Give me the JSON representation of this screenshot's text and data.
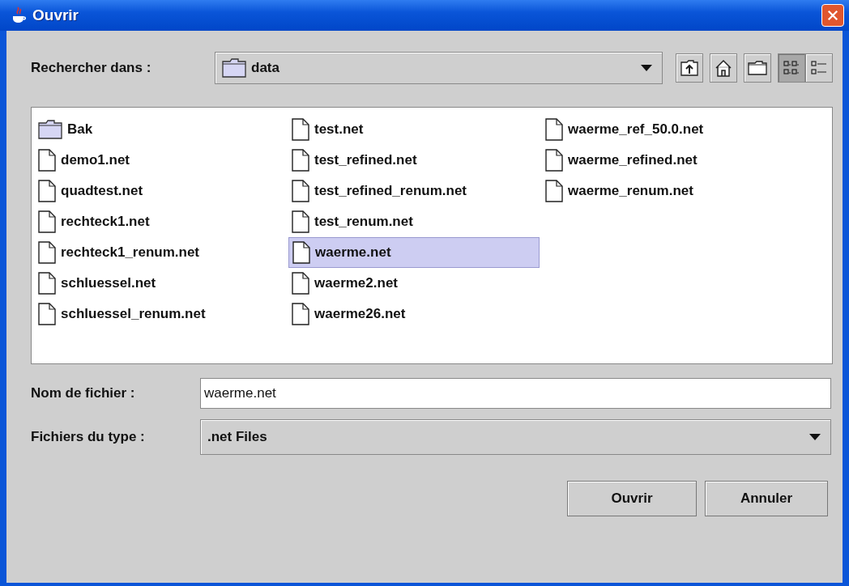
{
  "window": {
    "title": "Ouvrir"
  },
  "look_in": {
    "label": "Rechercher dans :",
    "value": "data"
  },
  "toolbar_buttons": [
    {
      "kind": "up",
      "selected": false
    },
    {
      "kind": "home",
      "selected": false
    },
    {
      "kind": "new_folder",
      "selected": false
    },
    {
      "kind": "list_view",
      "selected": true
    },
    {
      "kind": "details_view",
      "selected": false
    }
  ],
  "files": [
    {
      "name": "Bak",
      "kind": "folder",
      "selected": false
    },
    {
      "name": "demo1.net",
      "kind": "file",
      "selected": false
    },
    {
      "name": "quadtest.net",
      "kind": "file",
      "selected": false
    },
    {
      "name": "rechteck1.net",
      "kind": "file",
      "selected": false
    },
    {
      "name": "rechteck1_renum.net",
      "kind": "file",
      "selected": false
    },
    {
      "name": "schluessel.net",
      "kind": "file",
      "selected": false
    },
    {
      "name": "schluessel_renum.net",
      "kind": "file",
      "selected": false
    },
    {
      "name": "test.net",
      "kind": "file",
      "selected": false
    },
    {
      "name": "test_refined.net",
      "kind": "file",
      "selected": false
    },
    {
      "name": "test_refined_renum.net",
      "kind": "file",
      "selected": false
    },
    {
      "name": "test_renum.net",
      "kind": "file",
      "selected": false
    },
    {
      "name": "waerme.net",
      "kind": "file",
      "selected": true
    },
    {
      "name": "waerme2.net",
      "kind": "file",
      "selected": false
    },
    {
      "name": "waerme26.net",
      "kind": "file",
      "selected": false
    },
    {
      "name": "waerme_ref_50.0.net",
      "kind": "file",
      "selected": false
    },
    {
      "name": "waerme_refined.net",
      "kind": "file",
      "selected": false
    },
    {
      "name": "waerme_renum.net",
      "kind": "file",
      "selected": false
    }
  ],
  "file_name": {
    "label": "Nom de fichier :",
    "value": "waerme.net"
  },
  "file_type": {
    "label": "Fichiers du type :",
    "value": ".net Files"
  },
  "buttons": [
    "Ouvrir",
    "Annuler"
  ]
}
